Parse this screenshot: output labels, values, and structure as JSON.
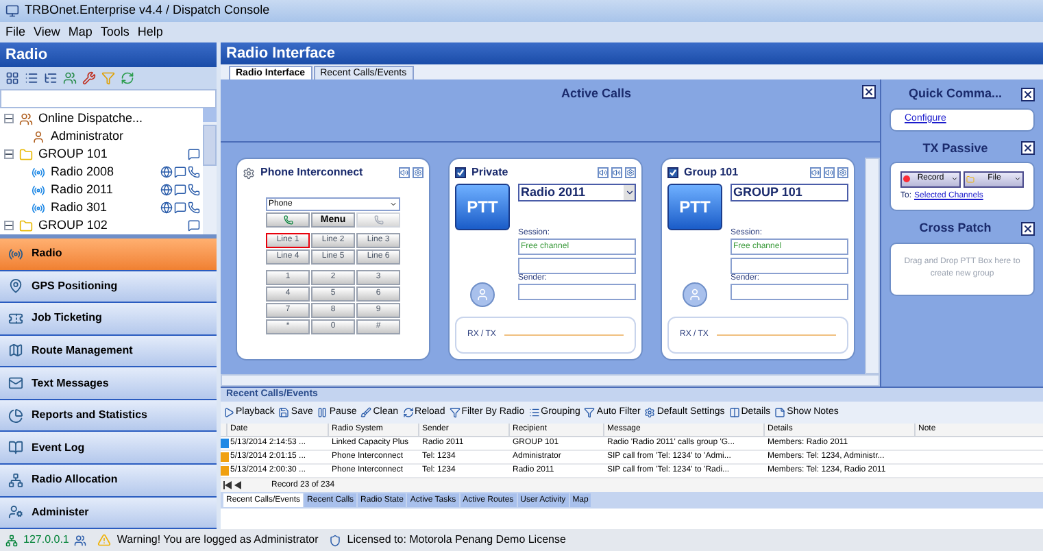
{
  "window": {
    "title": "TRBOnet.Enterprise v4.4 / Dispatch Console"
  },
  "menu": [
    "File",
    "View",
    "Map",
    "Tools",
    "Help"
  ],
  "radio_panel": {
    "title": "Radio",
    "tree": [
      {
        "label": "Online Dispatche...",
        "kind": "dispatchers",
        "expanded": true,
        "children": [
          {
            "label": "Administrator",
            "kind": "user"
          }
        ]
      },
      {
        "label": "GROUP 101",
        "kind": "group",
        "expanded": true,
        "children": [
          {
            "label": "Radio 2008",
            "kind": "radio"
          },
          {
            "label": "Radio 2011",
            "kind": "radio"
          },
          {
            "label": "Radio 301",
            "kind": "radio"
          }
        ]
      },
      {
        "label": "GROUP 102",
        "kind": "group",
        "expanded": true
      }
    ],
    "nav": [
      {
        "label": "Radio",
        "selected": true
      },
      {
        "label": "GPS Positioning",
        "selected": false
      },
      {
        "label": "Job Ticketing",
        "selected": false
      },
      {
        "label": "Route Management",
        "selected": false
      },
      {
        "label": "Text Messages",
        "selected": false
      },
      {
        "label": "Reports and Statistics",
        "selected": false
      },
      {
        "label": "Event Log",
        "selected": false
      },
      {
        "label": "Radio Allocation",
        "selected": false
      },
      {
        "label": "Administer",
        "selected": false
      }
    ]
  },
  "main": {
    "title": "Radio Interface",
    "tabs": [
      {
        "label": "Radio Interface",
        "selected": true
      },
      {
        "label": "Recent Calls/Events",
        "selected": false
      }
    ],
    "active_calls": {
      "title": "Active Calls",
      "phone": {
        "title": "Phone Interconnect",
        "field": "Phone",
        "menu": "Menu",
        "lines": [
          {
            "label": "Line 1",
            "selected": true
          },
          {
            "label": "Line 2",
            "selected": false
          },
          {
            "label": "Line 3",
            "selected": false
          },
          {
            "label": "Line 4",
            "selected": false
          },
          {
            "label": "Line 5",
            "selected": false
          },
          {
            "label": "Line 6",
            "selected": false
          }
        ],
        "keys": [
          "1",
          "2",
          "3",
          "4",
          "5",
          "6",
          "7",
          "8",
          "9",
          "*",
          "0",
          "#"
        ]
      },
      "cards": [
        {
          "kind": "dropdown",
          "checked": true,
          "title": "Private",
          "target": "Radio 2011",
          "ptt": "PTT",
          "session_label": "Session:",
          "session": "Free channel",
          "sender_label": "Sender:",
          "rxtx": "RX / TX"
        },
        {
          "kind": "text",
          "checked": true,
          "title": "Group 101",
          "target": "GROUP 101",
          "ptt": "PTT",
          "session_label": "Session:",
          "session": "Free channel",
          "sender_label": "Sender:",
          "rxtx": "RX / TX"
        }
      ]
    }
  },
  "quick_commands": {
    "title": "Quick Comma...",
    "link": "Configure"
  },
  "tx_passive": {
    "title": "TX Passive",
    "buttons": [
      "Record",
      "File"
    ],
    "to_label": "To:",
    "to_link": "Selected Channels"
  },
  "cross_patch": {
    "title": "Cross Patch",
    "hint": "Drag and Drop PTT Box here to create new group"
  },
  "recent": {
    "title": "Recent Calls/Events",
    "toolbar": [
      "Playback",
      "Save",
      "Pause",
      "Clean",
      "Reload",
      "Filter By Radio",
      "Grouping",
      "Auto Filter",
      "Default Settings",
      "Details",
      "Show Notes"
    ],
    "columns": [
      "Date",
      "Radio System",
      "Sender",
      "Recipient",
      "Message",
      "Details",
      "Note"
    ],
    "rows": [
      {
        "color": "#1e88e5",
        "selected": false,
        "cells": [
          "5/13/2014 2:14:53 ...",
          "Linked Capacity Plus",
          "Radio 2011",
          "GROUP 101",
          "Radio 'Radio 2011' calls group 'G...",
          "Members: Radio 2011",
          ""
        ]
      },
      {
        "color": "#f0a010",
        "selected": false,
        "cells": [
          "5/13/2014 2:01:15 ...",
          "Phone Interconnect",
          "Tel: 1234",
          "Administrator",
          "SIP call from 'Tel: 1234' to 'Admi...",
          "Members: Tel: 1234, Administr...",
          ""
        ]
      },
      {
        "color": "#f0a010",
        "selected": false,
        "cells": [
          "5/13/2014 2:00:30 ...",
          "Phone Interconnect",
          "Tel: 1234",
          "Radio 2011",
          "SIP call from 'Tel: 1234' to 'Radi...",
          "Members: Tel: 1234, Radio 2011",
          ""
        ]
      }
    ],
    "pager": "Record 23 of 234",
    "tabs": [
      {
        "label": "Recent Calls/Events",
        "selected": true
      },
      {
        "label": "Recent Calls",
        "selected": false
      },
      {
        "label": "Radio State",
        "selected": false
      },
      {
        "label": "Active Tasks",
        "selected": false
      },
      {
        "label": "Active Routes",
        "selected": false
      },
      {
        "label": "User Activity",
        "selected": false
      },
      {
        "label": "Map",
        "selected": false
      }
    ]
  },
  "status_bar": {
    "ip": "127.0.0.1",
    "warning": "Warning! You are logged as Administrator",
    "license": "Licensed to: Motorola Penang Demo License"
  }
}
